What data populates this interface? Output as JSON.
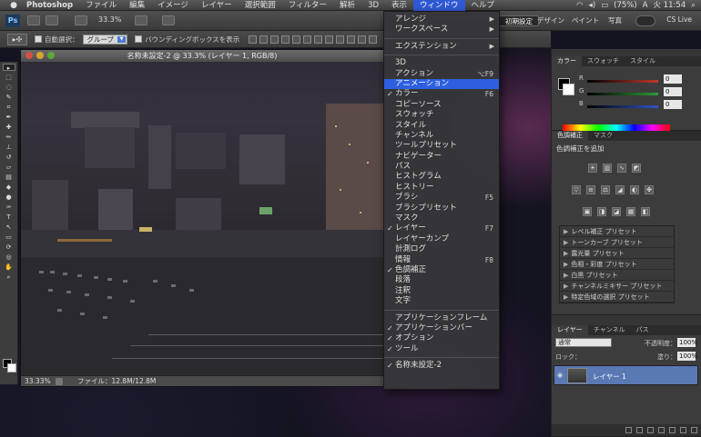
{
  "menubar": {
    "app_name": "Photoshop",
    "items": [
      "ファイル",
      "編集",
      "イメージ",
      "レイヤー",
      "選択範囲",
      "フィルター",
      "解析",
      "3D",
      "表示",
      "ウィンドウ",
      "ヘルプ"
    ],
    "battery": "(75%)",
    "clock": "火 11:54"
  },
  "appbar": {
    "logo": "Ps",
    "zoom": "33.3%",
    "workspace_active": "初期設定",
    "workspace_design": "デザイン",
    "workspace_paint": "ペイント",
    "workspace_photo": "写真",
    "cslive": "CS Live"
  },
  "optbar": {
    "tool_preset": "▸✣",
    "auto_select_label": "自動選択：",
    "auto_select_value": "グループ",
    "bounding_box_label": "バウンディングボックスを表示"
  },
  "document": {
    "title": "名称未設定-2 @ 33.3% (レイヤー 1, RGB/8)",
    "zoom": "33.33%",
    "file_info": "ファイル：12.8M/12.8M"
  },
  "panels": {
    "color_tabs": [
      "カラー",
      "スウォッチ",
      "スタイル"
    ],
    "color_sliders": [
      {
        "label": "R",
        "value": "0",
        "color": "#c0392b"
      },
      {
        "label": "G",
        "value": "0",
        "color": "#2e9b3a"
      },
      {
        "label": "B",
        "value": "0",
        "color": "#2f55c8"
      }
    ],
    "adjust_tabs": [
      "色調補正",
      "マスク"
    ],
    "adjust_label": "色調補正を追加",
    "presets": [
      "レベル補正 プリセット",
      "トーンカーブ プリセット",
      "露光量 プリセット",
      "色相・彩度 プリセット",
      "白黒 プリセット",
      "チャンネルミキサー プリセット",
      "特定色域の選択 プリセット"
    ],
    "layers_tabs": [
      "レイヤー",
      "チャンネル",
      "パス"
    ],
    "blend_mode": "通常",
    "opacity_label": "不透明度：",
    "opacity_value": "100%",
    "lock_label": "ロック：",
    "fill_label": "塗り：",
    "fill_value": "100%",
    "layer_name": "レイヤー 1"
  },
  "window_menu": {
    "groups": [
      [
        {
          "label": "アレンジ",
          "submenu": true
        },
        {
          "label": "ワークスペース",
          "submenu": true
        }
      ],
      [
        {
          "label": "エクステンション",
          "submenu": true
        }
      ],
      [
        {
          "label": "3D"
        },
        {
          "label": "アクション",
          "shortcut": "⌥F9"
        },
        {
          "label": "アニメーション",
          "selected": true
        },
        {
          "label": "カラー",
          "checked": true,
          "shortcut": "F6"
        },
        {
          "label": "コピーソース"
        },
        {
          "label": "スウォッチ"
        },
        {
          "label": "スタイル"
        },
        {
          "label": "チャンネル"
        },
        {
          "label": "ツールプリセット"
        },
        {
          "label": "ナビゲーター"
        },
        {
          "label": "パス"
        },
        {
          "label": "ヒストグラム"
        },
        {
          "label": "ヒストリー"
        },
        {
          "label": "ブラシ",
          "shortcut": "F5"
        },
        {
          "label": "ブラシプリセット"
        },
        {
          "label": "マスク"
        },
        {
          "label": "レイヤー",
          "checked": true,
          "shortcut": "F7"
        },
        {
          "label": "レイヤーカンプ"
        },
        {
          "label": "計測ログ"
        },
        {
          "label": "情報",
          "shortcut": "F8"
        },
        {
          "label": "色調補正",
          "checked": true
        },
        {
          "label": "段落"
        },
        {
          "label": "注釈"
        },
        {
          "label": "文字"
        }
      ],
      [
        {
          "label": "アプリケーションフレーム"
        },
        {
          "label": "アプリケーションバー",
          "checked": true
        },
        {
          "label": "オプション",
          "checked": true
        },
        {
          "label": "ツール",
          "checked": true
        }
      ],
      [
        {
          "label": "名称未設定-2",
          "checked": true
        }
      ]
    ]
  },
  "colors": {
    "menu_highlight": "#2d5fe0",
    "layer_selected": "#5a78b4"
  }
}
